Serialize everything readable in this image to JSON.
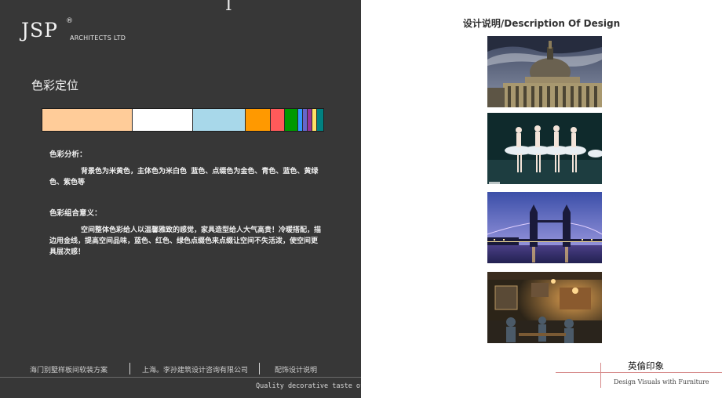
{
  "left": {
    "top_glyph": "I",
    "logo": {
      "mark": "JSP",
      "registered": "®",
      "subtitle": "ARCHITECTS LTD"
    },
    "section_title": "色彩定位",
    "palette": [
      {
        "color": "#ffcc99",
        "weight": 115
      },
      {
        "color": "#ffffff",
        "weight": 77
      },
      {
        "color": "#a8d8ea",
        "weight": 67
      },
      {
        "color": "#ff9900",
        "weight": 32
      },
      {
        "color": "#ff5a5a",
        "weight": 18
      },
      {
        "color": "#009900",
        "weight": 17
      },
      {
        "color": "#3399ff",
        "weight": 6
      },
      {
        "color": "#6666cc",
        "weight": 6
      },
      {
        "color": "#993399",
        "weight": 6
      },
      {
        "color": "#ffe066",
        "weight": 6
      },
      {
        "color": "#008080",
        "weight": 8
      }
    ],
    "analysis_heading": "色彩分析：",
    "analysis_text": "背景色为米黄色，主体色为米白色 蓝色、点缀色为金色、青色、蓝色、黄绿色、紫色等",
    "meaning_heading": "色彩组合意义：",
    "meaning_text": "空间整体色彩给人以温馨雅致的感觉，家具造型给人大气高贵！冷暖搭配，描边用金线，提高空间品味，蓝色、红色、绿色点缀色来点缀让空间不失活泼，使空间更具层次感！",
    "footer": {
      "project": "海门别墅样板间软装方案",
      "company": "上海。李孙建筑设计咨询有限公司",
      "section": "配饰设计说明",
      "tagline": "Quality decorative taste of l"
    }
  },
  "right": {
    "title": "设计说明/Description  Of  Design",
    "photos": [
      "cathedral-dome",
      "ballet-dancers",
      "tower-bridge-night",
      "pub-interior"
    ],
    "caption_title": "英倫印象",
    "caption_sub": "Design Visuals with Furniture"
  }
}
